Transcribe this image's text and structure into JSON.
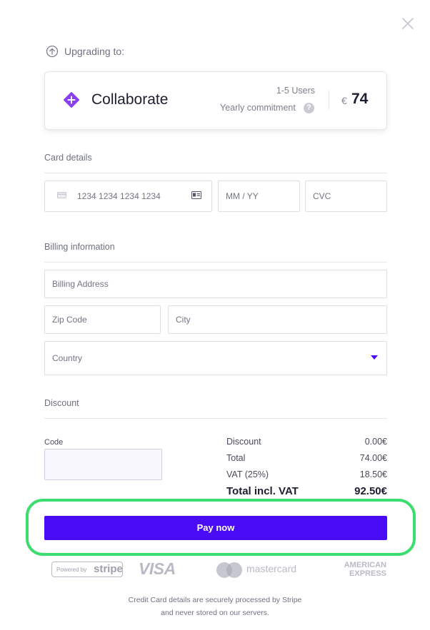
{
  "header": {
    "upgrading_label": "Upgrading to:"
  },
  "plan": {
    "name": "Collaborate",
    "users": "1-5 Users",
    "commitment": "Yearly commitment",
    "help": "?",
    "currency": "€",
    "price": "74"
  },
  "card_details": {
    "title": "Card details",
    "card_number_placeholder": "1234 1234 1234 1234",
    "expiry_placeholder": "MM / YY",
    "cvc_placeholder": "CVC"
  },
  "billing": {
    "title": "Billing information",
    "address_placeholder": "Billing Address",
    "zip_placeholder": "Zip Code",
    "city_placeholder": "City",
    "country_placeholder": "Country"
  },
  "discount": {
    "title": "Discount",
    "code_label": "Code",
    "code_value": ""
  },
  "summary": {
    "rows": [
      {
        "label": "Discount",
        "value": "0.00€"
      },
      {
        "label": "Total",
        "value": "74.00€"
      },
      {
        "label": "VAT (25%)",
        "value": "18.50€"
      }
    ],
    "total_label": "Total incl. VAT",
    "total_value": "92.50€"
  },
  "actions": {
    "pay_label": "Pay now"
  },
  "logos": {
    "powered_by": "Powered by",
    "stripe": "stripe",
    "visa": "VISA",
    "mastercard": "mastercard",
    "amex_line1": "AMERICAN",
    "amex_line2": "EXPRESS"
  },
  "footer": {
    "line1": "Credit Card details are securely processed by Stripe",
    "line2": "and never stored on our servers."
  },
  "colors": {
    "accent": "#4a0bf5",
    "plan_icon": "#8b3ff0",
    "highlight": "#3ddc6f"
  },
  "icons": {
    "close": "close-icon",
    "upgrade": "arrow-up-circle-icon",
    "plan": "plus-diamond-icon",
    "card_left": "credit-card-icon",
    "card_right": "card-id-icon",
    "dropdown": "caret-down-icon"
  }
}
